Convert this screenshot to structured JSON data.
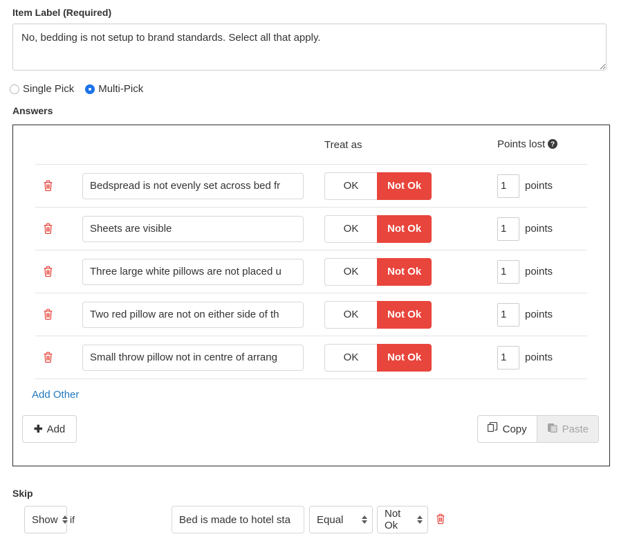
{
  "item_label": {
    "heading": "Item Label (Required)",
    "value": "No, bedding is not setup to brand standards. Select all that apply.",
    "placeholder": ""
  },
  "pick_type": {
    "options": [
      {
        "label": "Single Pick",
        "selected": false
      },
      {
        "label": "Multi-Pick",
        "selected": true
      }
    ]
  },
  "answers": {
    "heading": "Answers",
    "columns": {
      "delete": "",
      "text": "",
      "treat_as": "Treat as",
      "points_lost": "Points lost"
    },
    "treat_options": {
      "ok": "OK",
      "not_ok": "Not Ok"
    },
    "points_suffix": "points",
    "rows": [
      {
        "text": "Bedspread is not evenly set across bed fr",
        "treat_as": "Not Ok",
        "points": "1"
      },
      {
        "text": "Sheets are visible",
        "treat_as": "Not Ok",
        "points": "1"
      },
      {
        "text": "Three large white pillows are not placed u",
        "treat_as": "Not Ok",
        "points": "1"
      },
      {
        "text": "Two red pillow are not on either side of th",
        "treat_as": "Not Ok",
        "points": "1"
      },
      {
        "text": "Small throw pillow not in centre of arrang",
        "treat_as": "Not Ok",
        "points": "1"
      }
    ],
    "add_other_label": "Add Other",
    "add_button_label": "Add",
    "add_button_glyph": "✚",
    "copy_label": "Copy",
    "paste_label": "Paste"
  },
  "skip": {
    "heading": "Skip",
    "show_value": "Show",
    "if_label": "if",
    "question_value": "Bed is made to hotel sta",
    "operator_value": "Equal",
    "answer_value": "Not Ok"
  },
  "colors": {
    "accent_red": "#e8453c",
    "link_blue": "#2378bd",
    "radio_blue": "#1a73e8",
    "panel_border": "#2b2b2b"
  }
}
